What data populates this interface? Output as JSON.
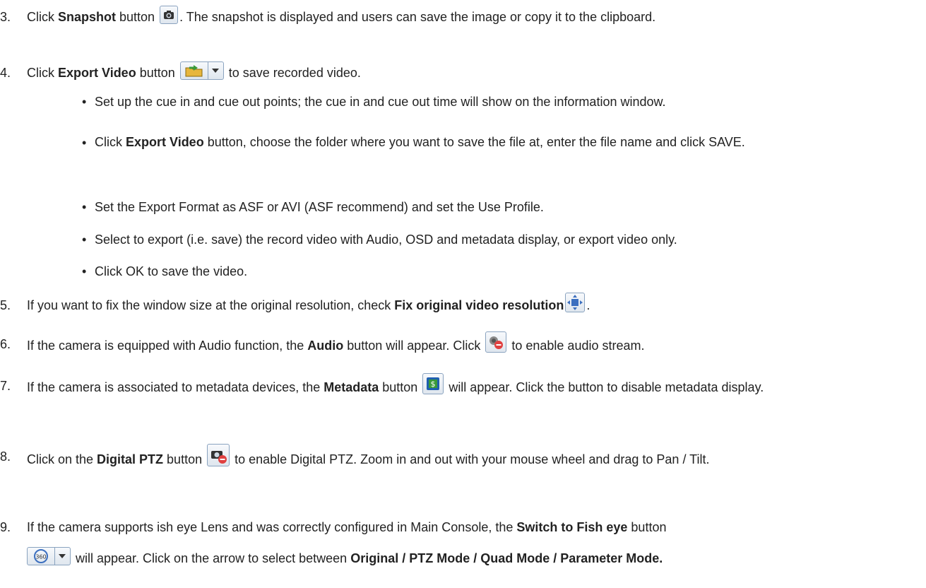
{
  "steps": [
    {
      "num": "3.",
      "pre": "Click ",
      "bold": "Snapshot",
      "mid": " button ",
      "post": ". The snapshot is displayed and users can save the image or copy it to the clipboard."
    },
    {
      "num": "4.",
      "pre": "Click ",
      "bold": "Export Video",
      "mid": " button ",
      "post": " to save recorded video."
    },
    {
      "num": "5.",
      "pre": "If you want to fix the window size at the original resolution, check ",
      "bold": "Fix original video resolution",
      "post": "."
    },
    {
      "num": "6.",
      "pre": "If the camera is equipped with Audio function, the ",
      "bold": "Audio",
      "mid": " button will appear. Click ",
      "post": " to enable audio stream."
    },
    {
      "num": "7.",
      "pre": "If the camera is associated to metadata devices, the ",
      "bold": "Metadata",
      "mid": " button ",
      "post": " will appear. Click the button to disable metadata display."
    },
    {
      "num": "8.",
      "pre": "Click on the ",
      "bold": "Digital PTZ",
      "mid": " button ",
      "post": " to enable Digital PTZ.  Zoom in and out with your mouse wheel and drag to Pan / Tilt."
    },
    {
      "num": "9.",
      "pre": "If the camera supports ish eye Lens and was correctly configured in Main Console, the ",
      "bold": "Switch to Fish eye",
      "mid": " button",
      "post": " will appear.  Click on the arrow to select between ",
      "bold2": "Original / PTZ Mode / Quad Mode / Parameter Mode."
    }
  ],
  "export_bullets": [
    {
      "text": "Set up the cue in and cue out points; the cue in and cue out time will show on the information window."
    },
    {
      "pre": "Click ",
      "bold": "Export Video",
      "post": " button, choose the folder where you want to save the file at, enter the file name and click SAVE."
    },
    {
      "text": "Set the Export Format as ASF or AVI (ASF recommend) and set the Use Profile."
    },
    {
      "text": "Select to export (i.e. save) the record video with Audio, OSD and metadata display, or export video only."
    },
    {
      "text": "Click OK to save the video."
    }
  ],
  "bullet_char": "•",
  "icons": [
    "camera-icon",
    "folder-export-icon",
    "fix-resolution-icon",
    "audio-icon",
    "metadata-icon",
    "digital-ptz-icon",
    "fisheye-360-icon",
    "dropdown-arrow-icon"
  ]
}
